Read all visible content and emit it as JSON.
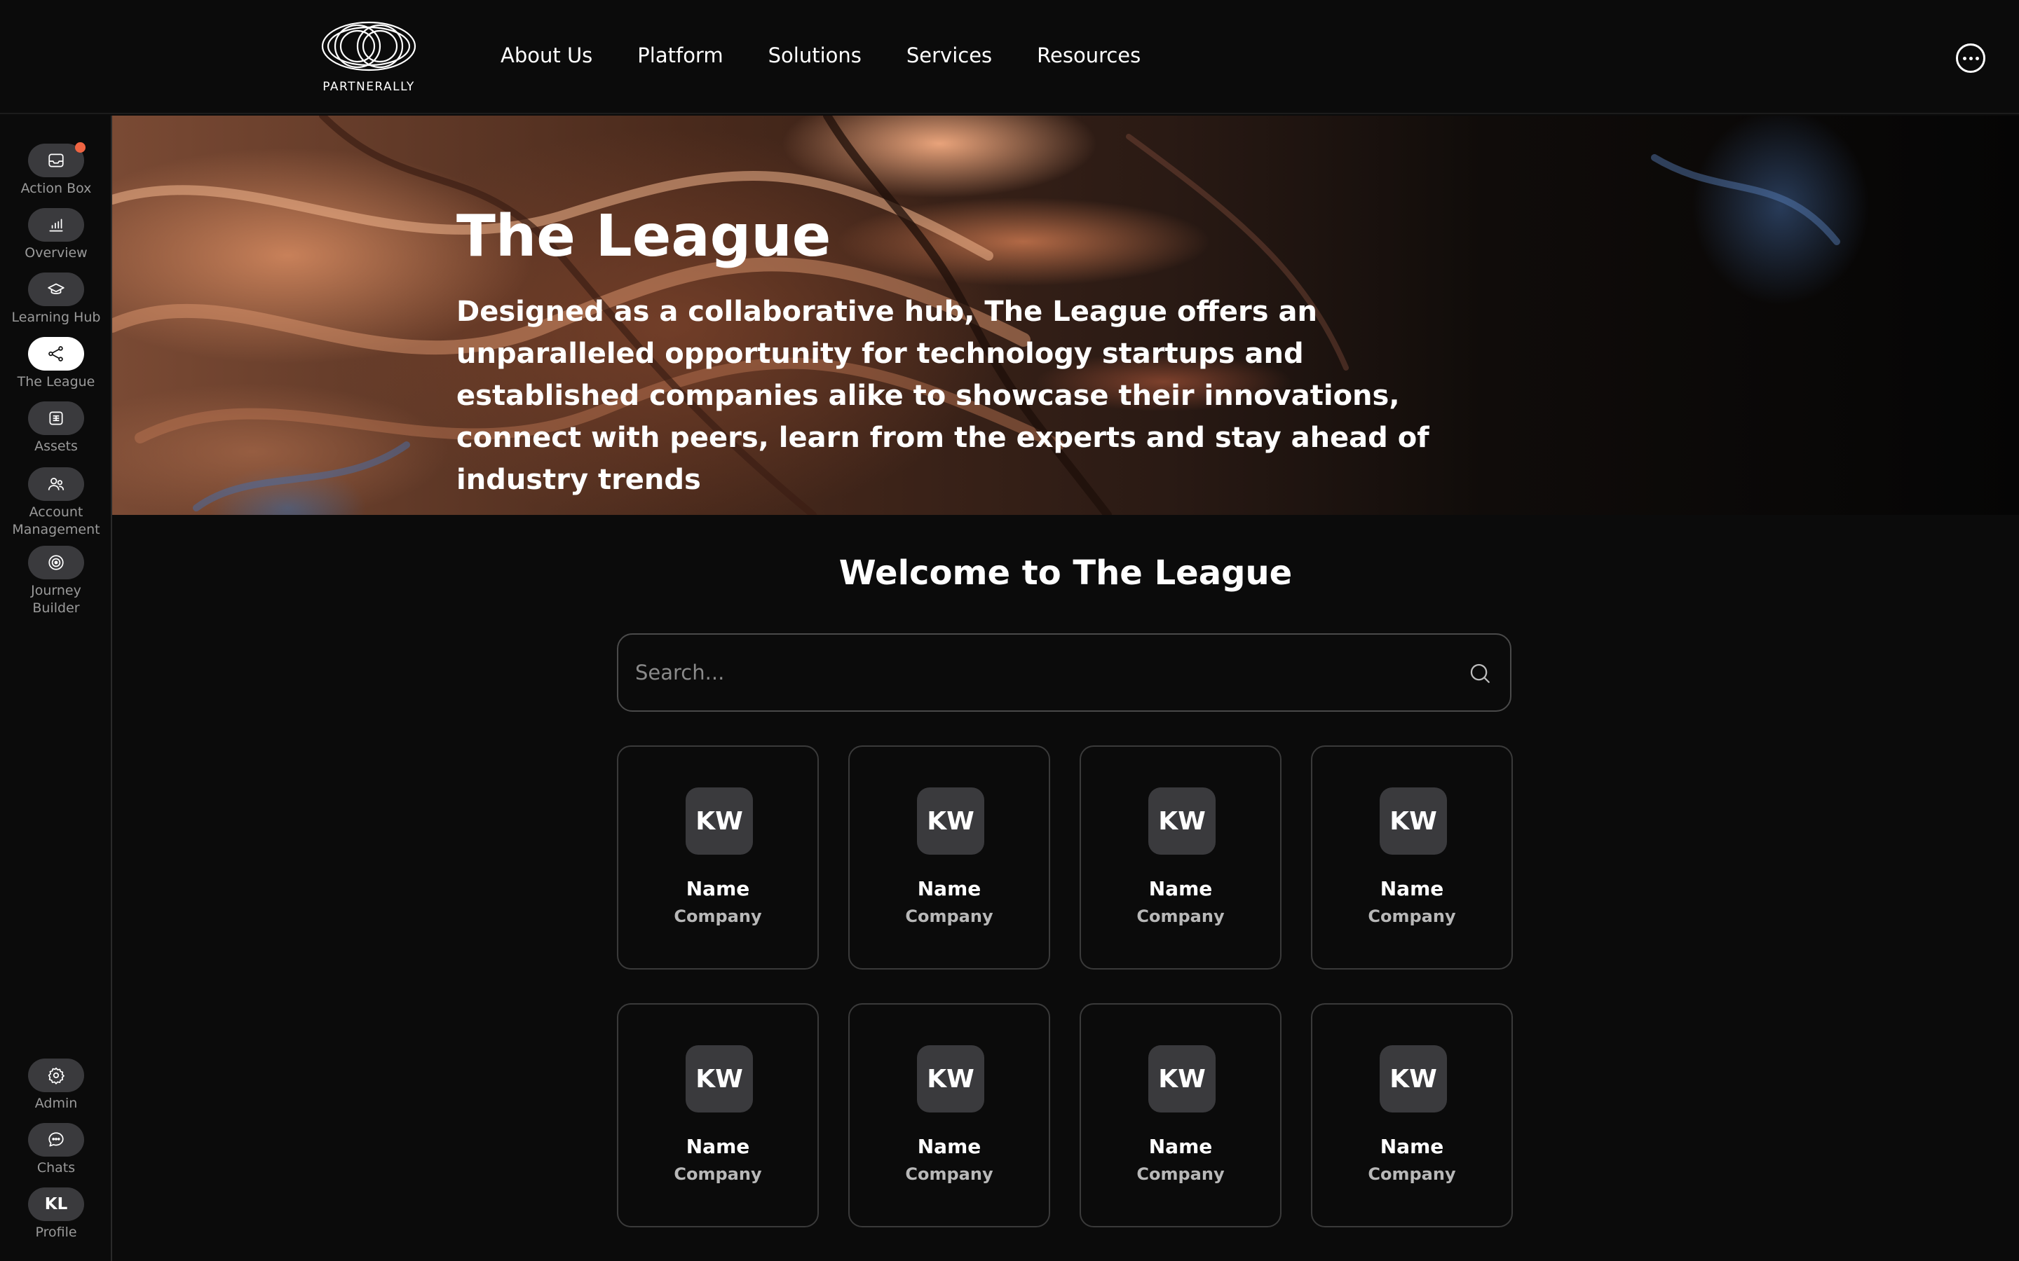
{
  "brand": {
    "name": "PARTNERALLY"
  },
  "nav": {
    "items": [
      {
        "label": "About Us"
      },
      {
        "label": "Platform"
      },
      {
        "label": "Solutions"
      },
      {
        "label": "Services"
      },
      {
        "label": "Resources"
      }
    ],
    "more_icon": "more-horizontal-icon"
  },
  "sidebar": {
    "items": [
      {
        "label": "Action Box",
        "icon": "inbox-icon",
        "has_notification": true,
        "notification_color": "#ef6442"
      },
      {
        "label": "Overview",
        "icon": "bar-chart-icon"
      },
      {
        "label": "Learning Hub",
        "icon": "graduation-cap-icon"
      },
      {
        "label": "The League",
        "icon": "network-icon",
        "active": true
      },
      {
        "label": "Assets",
        "icon": "asset-icon"
      },
      {
        "label": "Account\nManagement",
        "icon": "user-group-icon"
      },
      {
        "label": "Journey\nBuilder",
        "icon": "target-icon"
      }
    ],
    "bottom": [
      {
        "label": "Admin",
        "icon": "gear-icon"
      },
      {
        "label": "Chats",
        "icon": "chat-bubble-icon"
      },
      {
        "label": "Profile",
        "initials": "KL"
      }
    ]
  },
  "hero": {
    "title": "The League",
    "description": "Designed as a collaborative hub, The League offers an unparalleled opportunity for technology startups and established companies alike to showcase their innovations, connect with peers, learn from the experts and stay ahead of industry trends"
  },
  "main": {
    "welcome": "Welcome to The League",
    "search": {
      "placeholder": "Search...",
      "value": ""
    },
    "members": [
      {
        "initials": "KW",
        "name": "Name",
        "company": "Company"
      },
      {
        "initials": "KW",
        "name": "Name",
        "company": "Company"
      },
      {
        "initials": "KW",
        "name": "Name",
        "company": "Company"
      },
      {
        "initials": "KW",
        "name": "Name",
        "company": "Company"
      },
      {
        "initials": "KW",
        "name": "Name",
        "company": "Company"
      },
      {
        "initials": "KW",
        "name": "Name",
        "company": "Company"
      },
      {
        "initials": "KW",
        "name": "Name",
        "company": "Company"
      },
      {
        "initials": "KW",
        "name": "Name",
        "company": "Company"
      }
    ]
  },
  "colors": {
    "background": "#0b0b0b",
    "pill": "#3a3a3d",
    "active_pill": "#ffffff",
    "notification": "#ef6442"
  }
}
